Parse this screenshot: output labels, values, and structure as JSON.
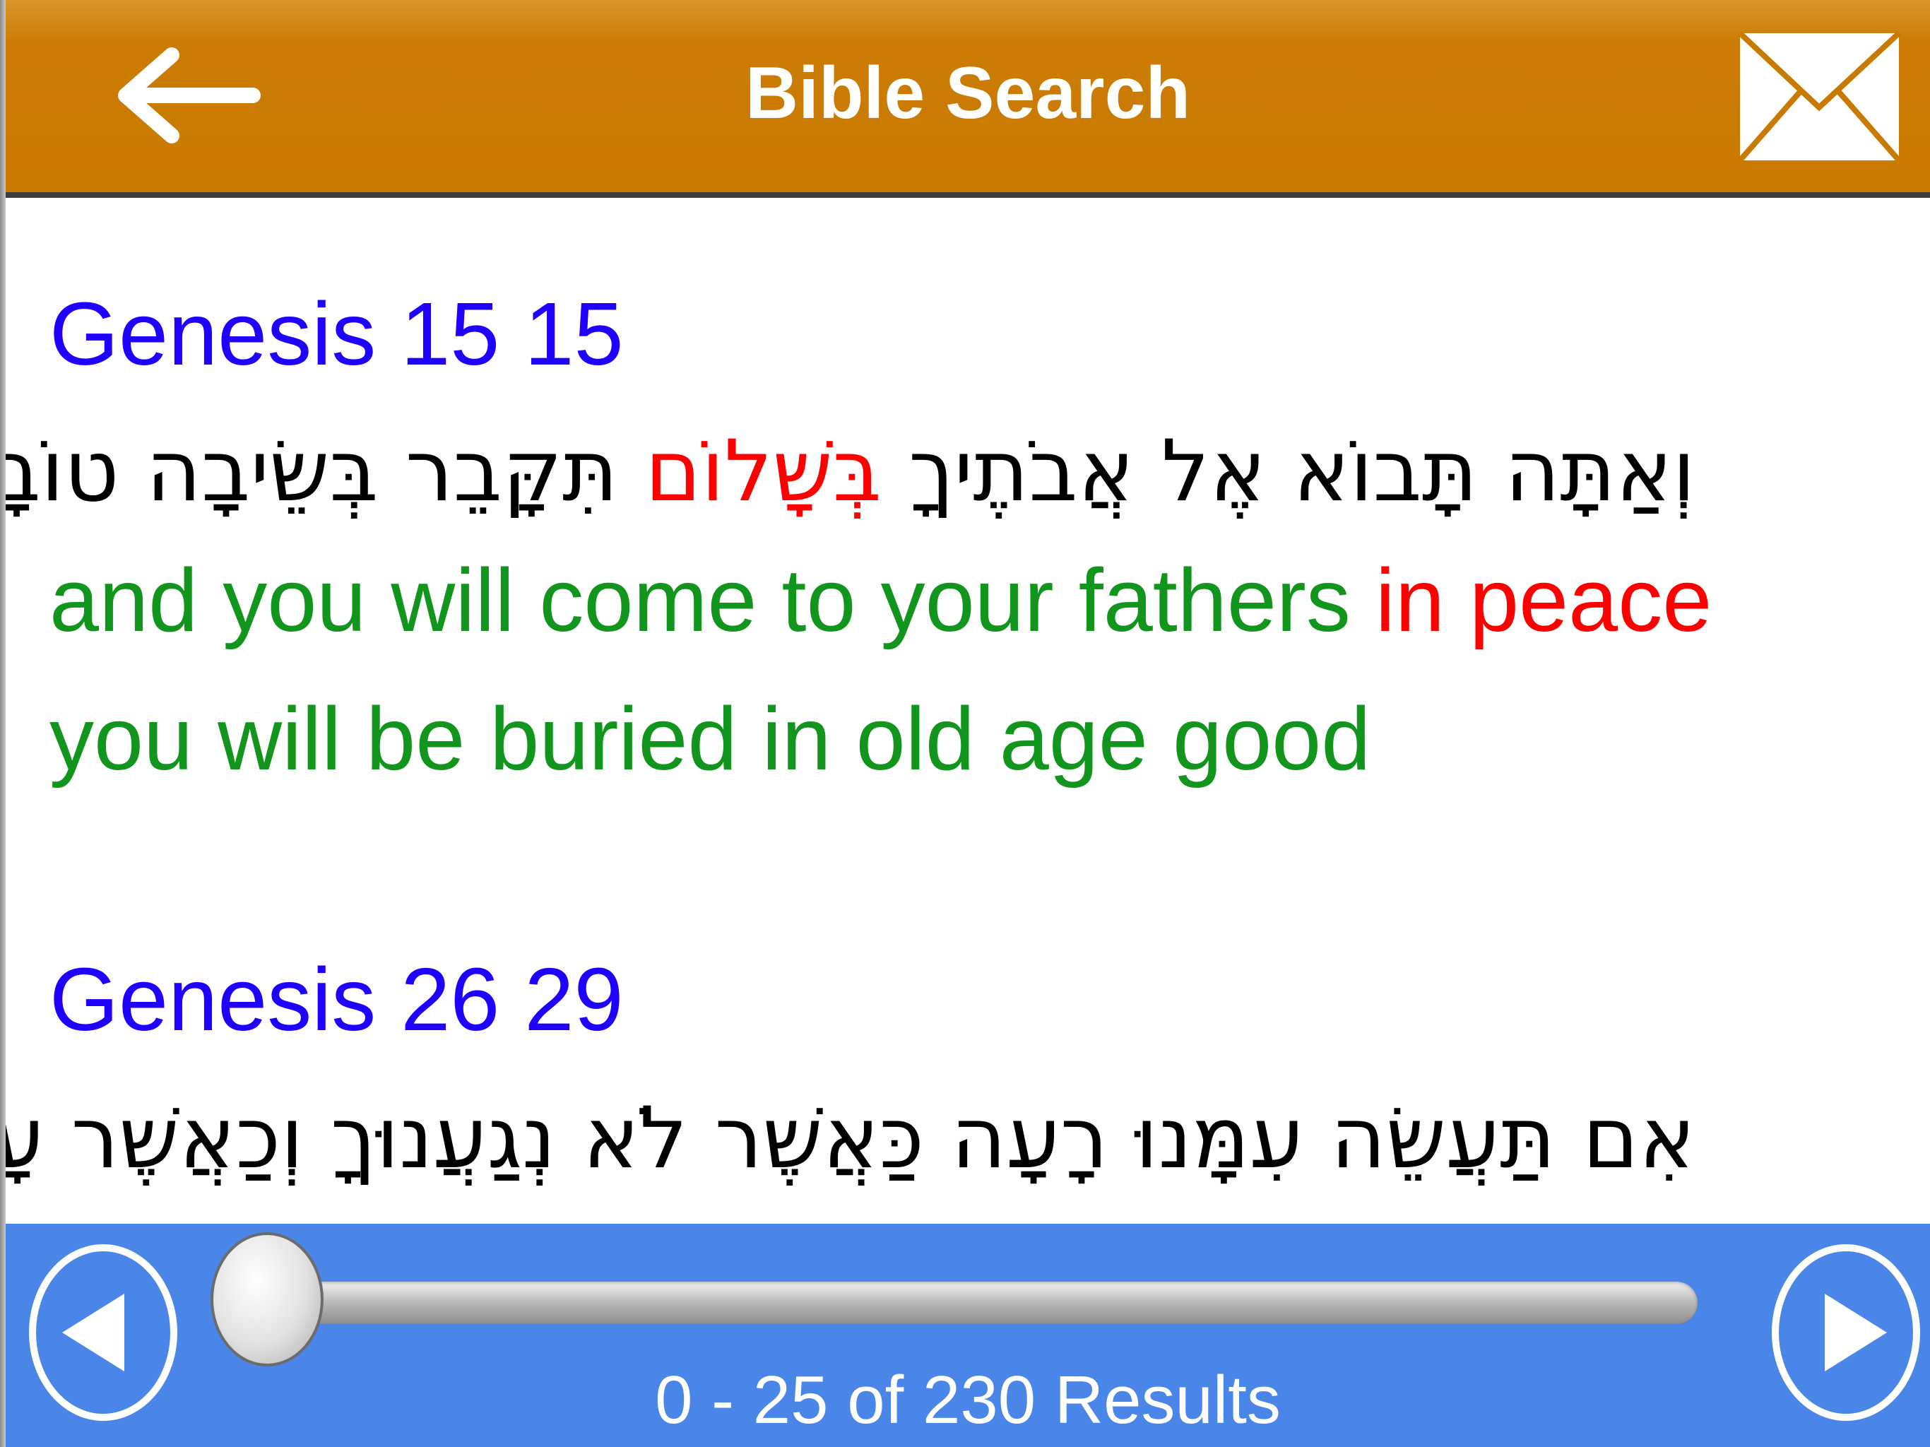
{
  "header": {
    "title": "Bible Search",
    "back_icon": "back-arrow-icon",
    "mail_icon": "envelope-icon",
    "color": "#c97a00"
  },
  "results": [
    {
      "reference": "Genesis 15 15",
      "hebrew_before": "וְאַתָּה תָּבוֹא אֶל אֲבֹתֶיךָ ",
      "hebrew_highlight": "בְּשָׁלוֹם",
      "hebrew_after": " תִּקָּבֵר בְּשֵׂיבָה טוֹבָה",
      "english_before": "and you will come to your fathers ",
      "english_highlight": "in peace",
      "english_after": " you will be buried in old age good"
    },
    {
      "reference": "Genesis 26 29",
      "hebrew_before": "אִם תַּעֲשֵׂה עִמָּנוּ רָעָה כַּאֲשֶׁר לֹא נְגַעֲנוּךָ וְכַאֲשֶׁר עָשִׂינוּ",
      "hebrew_highlight": "",
      "hebrew_after": ""
    }
  ],
  "pagination": {
    "results_text": "0 - 25 of 230 Results",
    "prev_icon": "prev-triangle-icon",
    "next_icon": "next-triangle-icon",
    "slider_position": 0,
    "bar_color": "#4a86e8"
  },
  "colors": {
    "reference": "#1f00ff",
    "translation": "#11951c",
    "highlight": "#ff0000"
  }
}
